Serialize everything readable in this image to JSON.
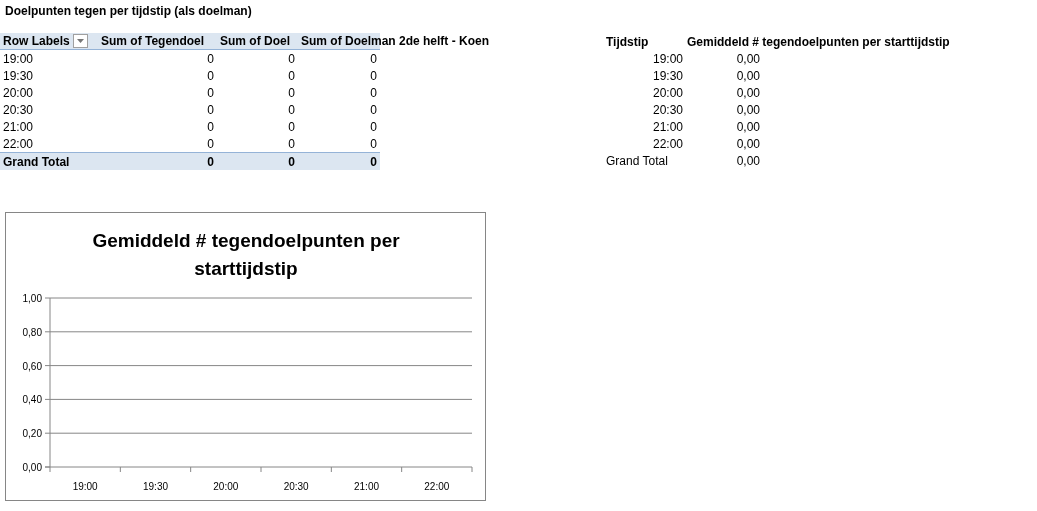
{
  "sheet_title": "Doelpunten tegen per tijdstip (als doelman)",
  "pivot_table": {
    "columns": [
      "Row Labels",
      "Sum of Tegendoel",
      "Sum of Doel",
      "Sum of Doelman 2de helft - Koen"
    ],
    "rows": [
      [
        "19:00",
        "0",
        "0",
        "0"
      ],
      [
        "19:30",
        "0",
        "0",
        "0"
      ],
      [
        "20:00",
        "0",
        "0",
        "0"
      ],
      [
        "20:30",
        "0",
        "0",
        "0"
      ],
      [
        "21:00",
        "0",
        "0",
        "0"
      ],
      [
        "22:00",
        "0",
        "0",
        "0"
      ]
    ],
    "grand_total": [
      "Grand Total",
      "0",
      "0",
      "0"
    ]
  },
  "average_table": {
    "columns": [
      "Tijdstip",
      "Gemiddeld # tegendoelpunten per starttijdstip"
    ],
    "rows": [
      [
        "19:00",
        "0,00"
      ],
      [
        "19:30",
        "0,00"
      ],
      [
        "20:00",
        "0,00"
      ],
      [
        "20:30",
        "0,00"
      ],
      [
        "21:00",
        "0,00"
      ],
      [
        "22:00",
        "0,00"
      ]
    ],
    "grand_total": [
      "Grand Total",
      "0,00"
    ]
  },
  "chart": {
    "chart_data": {
      "type": "line",
      "grid": true,
      "title": "Gemiddeld # tegendoelpunten per starttijdstip",
      "categories": [
        "19:00",
        "19:30",
        "20:00",
        "20:30",
        "21:00",
        "22:00"
      ],
      "ylim": [
        0,
        1
      ],
      "yticks": [
        {
          "value": 0,
          "label": "0,00"
        },
        {
          "value": 0.2,
          "label": "0,20"
        },
        {
          "value": 0.4,
          "label": "0,40"
        },
        {
          "value": 0.6,
          "label": "0,60"
        },
        {
          "value": 0.8,
          "label": "0,80"
        },
        {
          "value": 1,
          "label": "1,00"
        }
      ]
    }
  }
}
